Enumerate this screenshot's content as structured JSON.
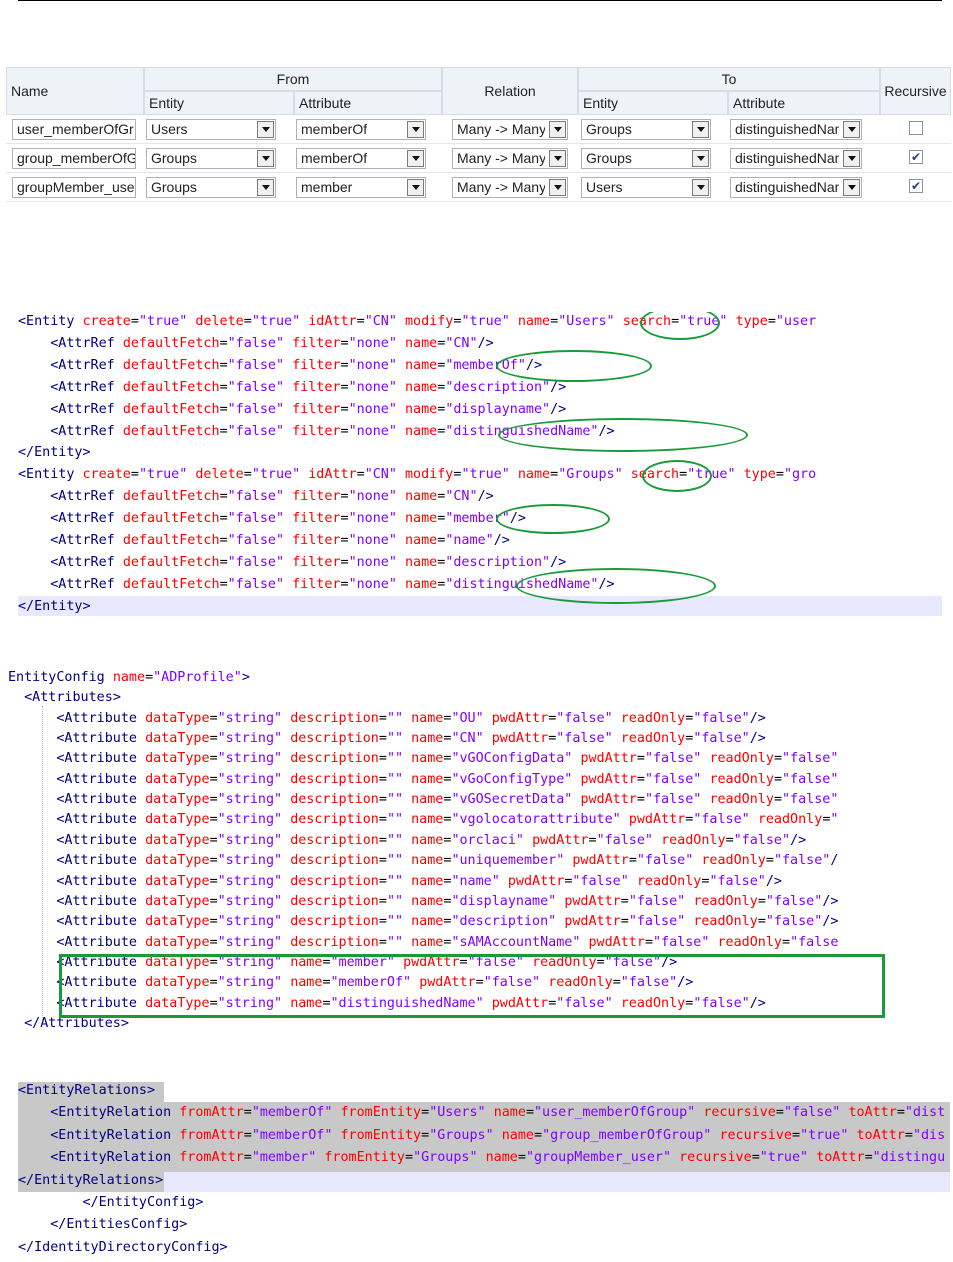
{
  "table": {
    "headers": {
      "name": "Name",
      "from": "From",
      "entity": "Entity",
      "attribute": "Attribute",
      "relation": "Relation",
      "to": "To",
      "to_entity": "Entity",
      "to_attribute": "Attribute",
      "recursive": "Recursive"
    },
    "rows": [
      {
        "name": "user_memberOfGr",
        "from_entity": "Users",
        "from_attr": "memberOf",
        "relation": "Many -> Many",
        "to_entity": "Groups",
        "to_attr": "distinguishedName",
        "recursive": false
      },
      {
        "name": "group_memberOfG",
        "from_entity": "Groups",
        "from_attr": "memberOf",
        "relation": "Many -> Many",
        "to_entity": "Groups",
        "to_attr": "distinguishedName",
        "recursive": true
      },
      {
        "name": "groupMember_use",
        "from_entity": "Groups",
        "from_attr": "member",
        "relation": "Many -> Many",
        "to_entity": "Users",
        "to_attr": "distinguishedName",
        "recursive": true
      }
    ]
  },
  "xml1": [
    "<Entity create=\"true\" delete=\"true\" idAttr=\"CN\" modify=\"true\" name=\"Users\" search=\"true\" type=\"user",
    "    <AttrRef defaultFetch=\"false\" filter=\"none\" name=\"CN\"/>",
    "    <AttrRef defaultFetch=\"false\" filter=\"none\" name=\"memberOf\"/>",
    "    <AttrRef defaultFetch=\"false\" filter=\"none\" name=\"description\"/>",
    "    <AttrRef defaultFetch=\"false\" filter=\"none\" name=\"displayname\"/>",
    "    <AttrRef defaultFetch=\"false\" filter=\"none\" name=\"distinguishedName\"/>",
    "</Entity>",
    "<Entity create=\"true\" delete=\"true\" idAttr=\"CN\" modify=\"true\" name=\"Groups\" search=\"true\" type=\"gro",
    "    <AttrRef defaultFetch=\"false\" filter=\"none\" name=\"CN\"/>",
    "    <AttrRef defaultFetch=\"false\" filter=\"none\" name=\"member\"/>",
    "    <AttrRef defaultFetch=\"false\" filter=\"none\" name=\"name\"/>",
    "    <AttrRef defaultFetch=\"false\" filter=\"none\" name=\"description\"/>",
    "    <AttrRef defaultFetch=\"false\" filter=\"none\" name=\"distinguishedName\"/>",
    "</Entity>"
  ],
  "xml2": [
    "EntityConfig name=\"ADProfile\">",
    "  <Attributes>",
    "      <Attribute dataType=\"string\" description=\"\" name=\"OU\" pwdAttr=\"false\" readOnly=\"false\"/>",
    "      <Attribute dataType=\"string\" description=\"\" name=\"CN\" pwdAttr=\"false\" readOnly=\"false\"/>",
    "      <Attribute dataType=\"string\" description=\"\" name=\"vGOConfigData\" pwdAttr=\"false\" readOnly=\"false\"",
    "      <Attribute dataType=\"string\" description=\"\" name=\"vGoConfigType\" pwdAttr=\"false\" readOnly=\"false\"",
    "      <Attribute dataType=\"string\" description=\"\" name=\"vGOSecretData\" pwdAttr=\"false\" readOnly=\"false\"",
    "      <Attribute dataType=\"string\" description=\"\" name=\"vgolocatorattribute\" pwdAttr=\"false\" readOnly=\"",
    "      <Attribute dataType=\"string\" description=\"\" name=\"orclaci\" pwdAttr=\"false\" readOnly=\"false\"/>",
    "      <Attribute dataType=\"string\" description=\"\" name=\"uniquemember\" pwdAttr=\"false\" readOnly=\"false\"/",
    "      <Attribute dataType=\"string\" description=\"\" name=\"name\" pwdAttr=\"false\" readOnly=\"false\"/>",
    "      <Attribute dataType=\"string\" description=\"\" name=\"displayname\" pwdAttr=\"false\" readOnly=\"false\"/>",
    "      <Attribute dataType=\"string\" description=\"\" name=\"description\" pwdAttr=\"false\" readOnly=\"false\"/>",
    "      <Attribute dataType=\"string\" description=\"\" name=\"sAMAccountName\" pwdAttr=\"false\" readOnly=\"false",
    "      <Attribute dataType=\"string\" name=\"member\" pwdAttr=\"false\" readOnly=\"false\"/>",
    "      <Attribute dataType=\"string\" name=\"memberOf\" pwdAttr=\"false\" readOnly=\"false\"/>",
    "      <Attribute dataType=\"string\" name=\"distinguishedName\" pwdAttr=\"false\" readOnly=\"false\"/>",
    "  </Attributes>"
  ],
  "xml3": [
    "<EntityRelations>",
    "    <EntityRelation fromAttr=\"memberOf\" fromEntity=\"Users\" name=\"user_memberOfGroup\" recursive=\"false\" toAttr=\"dist",
    "    <EntityRelation fromAttr=\"memberOf\" fromEntity=\"Groups\" name=\"group_memberOfGroup\" recursive=\"true\" toAttr=\"dis",
    "    <EntityRelation fromAttr=\"member\" fromEntity=\"Groups\" name=\"groupMember_user\" recursive=\"true\" toAttr=\"distingu",
    "</EntityRelations>",
    "        </EntityConfig>",
    "    </EntitiesConfig>",
    "</IdentityDirectoryConfig>"
  ]
}
